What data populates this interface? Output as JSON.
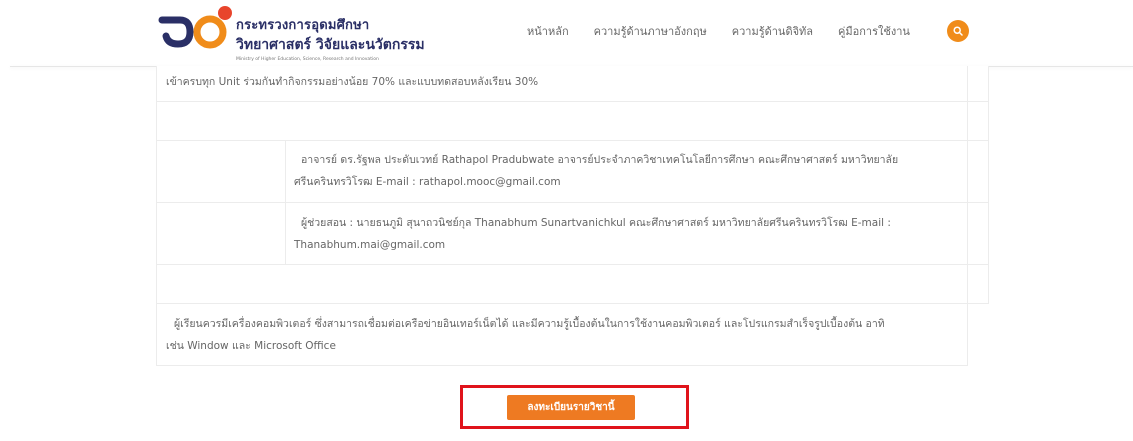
{
  "header": {
    "logo": {
      "line1": "กระทรวงการอุดมศึกษา",
      "line2": "วิทยาศาสตร์ วิจัยและนวัตกรรม",
      "line3": "Ministry of Higher Education, Science, Research and Innovation"
    },
    "nav": [
      {
        "label": "หน้าหลัก"
      },
      {
        "label": "ความรู้ด้านภาษาอังกฤษ"
      },
      {
        "label": "ความรู้ด้านดิจิทัล"
      },
      {
        "label": "คู่มือการใช้งาน"
      }
    ],
    "search_icon": "search-icon",
    "accent_color": "#f08c1a"
  },
  "content": {
    "criteria_text": "เข้าครบทุก Unit ร่วมกันทำกิจกรรมอย่างน้อย 70%  และแบบทดสอบหลังเรียน 30%",
    "instructor": {
      "line1": "อาจารย์ ดร.รัฐพล  ประดับเวทย์  Rathapol  Pradubwate   อาจารย์ประจำภาควิชาเทคโนโลยีการศึกษา คณะศึกษาศาสตร์ มหาวิทยาลัย",
      "line2": "ศรีนครินทรวิโรฒ E-mail : rathapol.mooc@gmail.com"
    },
    "assistant": {
      "line1": "ผู้ช่วยสอน : นายธนภูมิ  สุนาถวนิชย์กุล Thanabhum  Sunartvanichkul คณะศึกษาศาสตร์ มหาวิทยาลัยศรีนครินทรวิโรฒ E-mail :",
      "line2": "Thanabhum.mai@gmail.com"
    },
    "prerequisite": {
      "line1": "ผู้เรียนควรมีเครื่องคอมพิวเตอร์ ซึ่งสามารถเชื่อมต่อเครือข่ายอินเทอร์เน็ตได้ และมีความรู้เบื้องต้นในการใช้งานคอมพิวเตอร์ และโปรแกรมสำเร็จรูปเบื้องต้น อาทิ",
      "line2": "เช่น Window และ Microsoft Office"
    }
  },
  "register": {
    "label": "ลงทะเบียนรายวิชานี้",
    "button_color": "#ee7a22",
    "highlight_color": "#e0131b"
  }
}
